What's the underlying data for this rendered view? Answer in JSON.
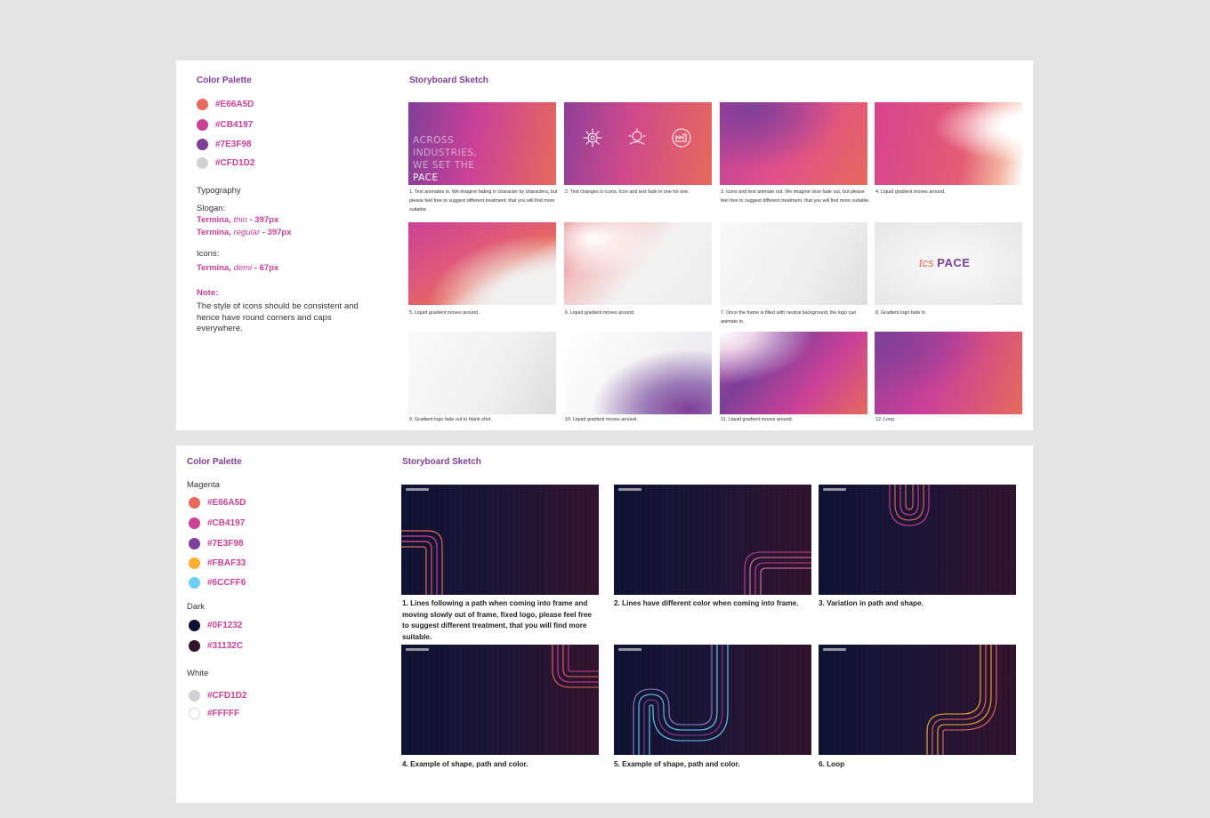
{
  "panel1": {
    "color_palette_title": "Color Palette",
    "storyboard_title": "Storyboard Sketch",
    "swatches": [
      {
        "hex": "#E66A5D",
        "color": "#E66A5D"
      },
      {
        "hex": "#CB4197",
        "color": "#CB4197"
      },
      {
        "hex": "#7E3F98",
        "color": "#7E3F98"
      },
      {
        "hex": "#CFD1D2",
        "color": "#CFD1D2"
      }
    ],
    "typography_title": "Typography",
    "slogan_label": "Slogan:",
    "slogan_font1_name": "Termina, ",
    "slogan_font1_weight": "thin",
    "slogan_font1_size": " - 397px",
    "slogan_font2_name": "Termina, ",
    "slogan_font2_weight": "regular",
    "slogan_font2_size": " - 397px",
    "icons_label": "Icons:",
    "icons_font_name": "Termina, ",
    "icons_font_weight": "demi",
    "icons_font_size": " - 67px",
    "note_title": "Note:",
    "note_body": "The style of icons should be consistent and hence have round corners and caps everywhere.",
    "frame1_slogan": [
      "ACROSS",
      "INDUSTRIES,",
      "WE SET THE"
    ],
    "frame1_pace": "PACE",
    "frame2_icon_labels": [
      "",
      "",
      ""
    ],
    "frame8_logo_tcs": "tcs",
    "frame8_logo_pace": "PACE",
    "captions": [
      "1. Text animates in. We imagine fading in character by characters, but please feel free to suggest different treatment, that you will find more suitable.",
      "2. Text changes to icons. Icon and text fade in one for one.",
      "3. Icons and text animate out. We imagine slow fade out, but please feel free to suggest different treatment, that you will find more suitable.",
      "4. Liquid gradient moves around.",
      "5. Liquid gradient moves around.",
      "6. Liquid gradient moves around.",
      "7. Once the frame is filled with neutral background, the logo can animate in.",
      "8. Gradient logo fade in.",
      "9. Gradient logo fade out to blank shot.",
      "10. Liquid gradient moves around.",
      "11. Liquid gradient moves around.",
      "12. Loop."
    ]
  },
  "panel2": {
    "color_palette_title": "Color Palette",
    "storyboard_title": "Storyboard Sketch",
    "magenta_label": "Magenta",
    "magenta": [
      {
        "hex": "#E66A5D",
        "color": "#E66A5D"
      },
      {
        "hex": "#CB4197",
        "color": "#CB4197"
      },
      {
        "hex": "#7E3F98",
        "color": "#7E3F98"
      },
      {
        "hex": "#FBAF33",
        "color": "#FBAF33"
      },
      {
        "hex": "#6CCFF6",
        "color": "#6CCFF6"
      }
    ],
    "dark_label": "Dark",
    "dark": [
      {
        "hex": "#0F1232",
        "color": "#0F1232"
      },
      {
        "hex": "#31132C",
        "color": "#31132C"
      }
    ],
    "white_label": "White",
    "white": [
      {
        "hex": "#CFD1D2",
        "color": "#CFD1D2"
      },
      {
        "hex": "#FFFFF",
        "color": "#FFFFFF"
      }
    ],
    "captions": [
      "1. Lines following a path when coming into frame and moving slowly out of frame, fixed logo, please feel free to suggest different treatment, that you will find more suitable.",
      "2. Lines have different color when coming into frame.",
      "3. Variation in path and shape.",
      "4. Example of shape, path and color.",
      "5. Example of shape, path and color.",
      "6. Loop"
    ]
  }
}
